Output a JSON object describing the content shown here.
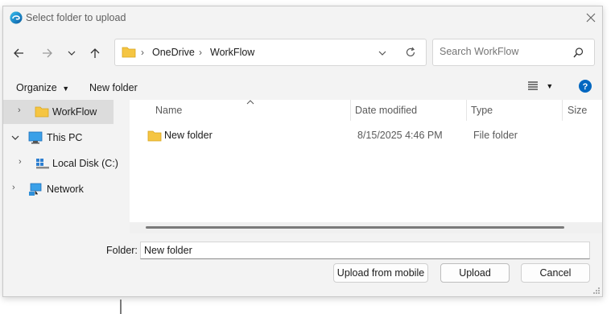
{
  "window": {
    "title": "Select folder to upload"
  },
  "address": {
    "crumbs": [
      "OneDrive",
      "WorkFlow"
    ]
  },
  "search": {
    "placeholder": "Search WorkFlow"
  },
  "toolbar": {
    "organize_label": "Organize",
    "new_folder_label": "New folder"
  },
  "nav": {
    "items": [
      {
        "label": "WorkFlow"
      },
      {
        "label": "This PC"
      },
      {
        "label": "Local Disk (C:)"
      },
      {
        "label": "Network"
      }
    ]
  },
  "table": {
    "columns": [
      "Name",
      "Date modified",
      "Type",
      "Size"
    ],
    "rows": [
      {
        "name": "New folder",
        "date": "8/15/2025 4:46 PM",
        "type": "File folder",
        "size": ""
      }
    ]
  },
  "footer": {
    "folder_label": "Folder:",
    "folder_value": "New folder",
    "upload_mobile_label": "Upload from mobile",
    "upload_label": "Upload",
    "cancel_label": "Cancel"
  },
  "colors": {
    "accent": "#0067c0",
    "folder": "#f5c542",
    "selected_bg": "#dcdcdc"
  }
}
